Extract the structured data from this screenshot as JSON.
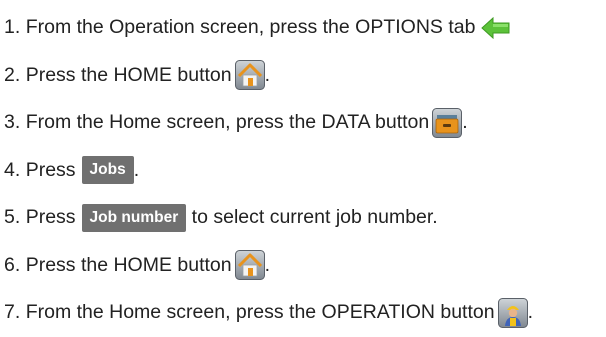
{
  "steps": [
    {
      "number": "1.",
      "text": "From the Operation screen, press the OPTIONS tab",
      "icon": "green-left-arrow-icon",
      "after": ""
    },
    {
      "number": "2.",
      "text": "Press the HOME button",
      "icon": "home-icon",
      "after": "."
    },
    {
      "number": "3.",
      "text": "From the Home screen, press the DATA button",
      "icon": "data-drawer-icon",
      "after": "."
    },
    {
      "number": "4.",
      "text": "Press",
      "button_label": "Jobs",
      "after": "."
    },
    {
      "number": "5.",
      "text": "Press",
      "button_label": "Job number",
      "after": "to select current job number."
    },
    {
      "number": "6.",
      "text": "Press the HOME button",
      "icon": "home-icon",
      "after": "."
    },
    {
      "number": "7.",
      "text": "From the Home screen, press the OPERATION button",
      "icon": "operator-icon",
      "after": "."
    }
  ],
  "colors": {
    "arrow_green": "#5cc23a",
    "icon_orange": "#e8931c",
    "button_gray": "#707070"
  }
}
